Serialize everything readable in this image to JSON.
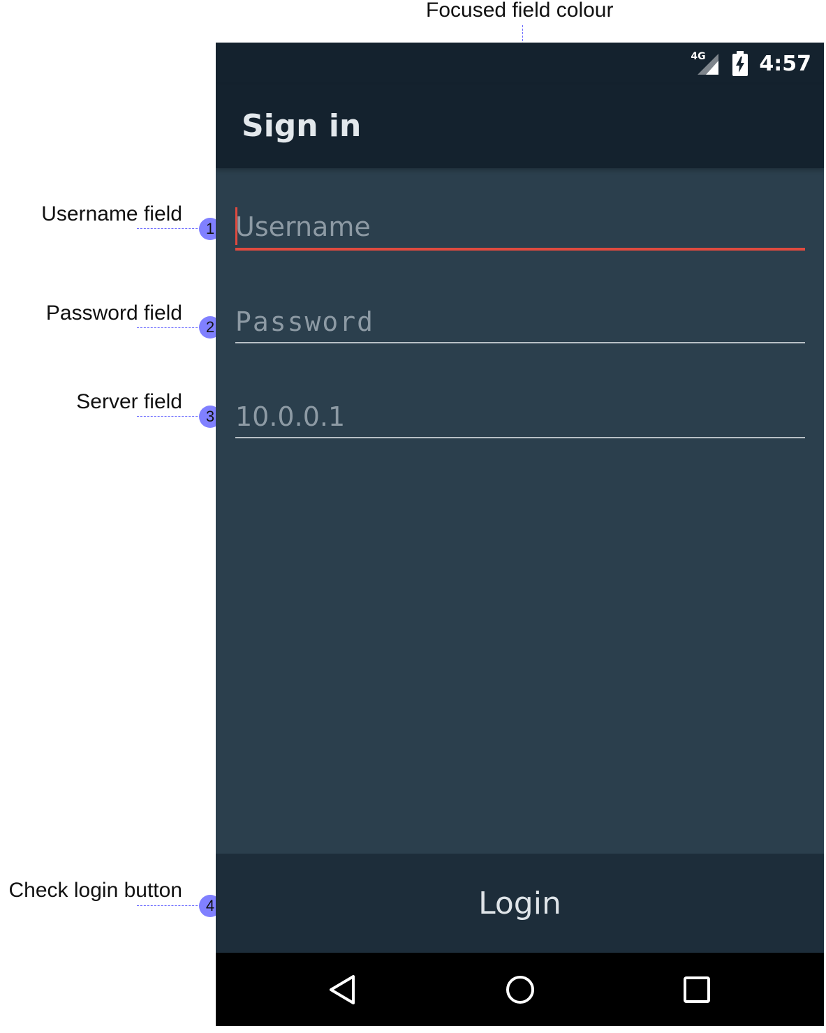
{
  "annotations": {
    "top": "Focused field colour",
    "items": [
      {
        "number": "1",
        "label": "Username field"
      },
      {
        "number": "2",
        "label": "Password field"
      },
      {
        "number": "3",
        "label": "Server field"
      },
      {
        "number": "4",
        "label": "Check login button"
      }
    ]
  },
  "status_bar": {
    "network": "4G",
    "time": "4:57"
  },
  "app_bar": {
    "title": "Sign in"
  },
  "form": {
    "username_placeholder": "Username",
    "password_placeholder": "Password",
    "server_placeholder": "10.0.0.1"
  },
  "login_button": {
    "label": "Login"
  },
  "nav_bar": {
    "back_icon": "back-triangle-icon",
    "home_icon": "home-circle-icon",
    "recents_icon": "recents-square-icon"
  },
  "colors": {
    "focus_accent": "#e04a3f",
    "app_bar": "#14222e",
    "content_bg": "#2b3f4d",
    "annotation": "#8080ff"
  }
}
